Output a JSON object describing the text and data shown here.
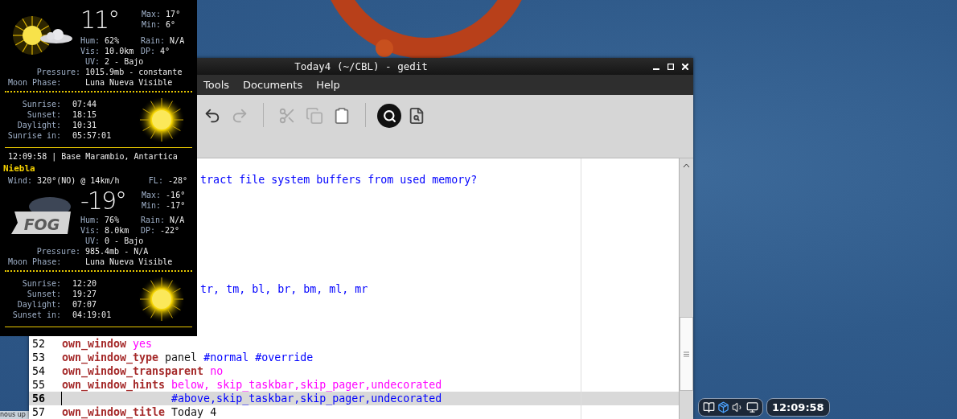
{
  "conky": {
    "blocks": [
      {
        "kind": "sun-cloud",
        "temp": "11°",
        "max": {
          "label": "Max:",
          "value": "17°"
        },
        "min": {
          "label": "Min:",
          "value": "6°"
        },
        "hum": {
          "label": "Hum:",
          "value": "62%"
        },
        "rain": {
          "label": "Rain:",
          "value": "N/A"
        },
        "vis": {
          "label": "Vis:",
          "value": "10.0km"
        },
        "dp": {
          "label": "DP:",
          "value": "4°"
        },
        "uv": {
          "label": "UV:",
          "value": "2 - Bajo"
        },
        "pressure": {
          "label": "Pressure:",
          "value": "1015.9mb - constante"
        },
        "moon": {
          "label": "Moon Phase:",
          "value": "Luna Nueva Visible"
        },
        "sun": [
          {
            "label": "Sunrise:",
            "value": "07:44"
          },
          {
            "label": "Sunset:",
            "value": "18:15"
          },
          {
            "label": "Daylight:",
            "value": "10:31"
          },
          {
            "label": "Sunrise in:",
            "value": "05:57:01"
          }
        ]
      },
      {
        "kind": "fog",
        "header": "12:09:58 | Base Marambio, Antartica",
        "condition": "Niebla",
        "wind": {
          "label": "Wind:",
          "value": "320°(NO) @ 14km/h"
        },
        "feels": {
          "label": "FL:",
          "value": "-28°"
        },
        "icon_label": "FOG",
        "temp": "-19°",
        "max": {
          "label": "Max:",
          "value": "-16°"
        },
        "min": {
          "label": "Min:",
          "value": "-17°"
        },
        "hum": {
          "label": "Hum:",
          "value": "76%"
        },
        "rain": {
          "label": "Rain:",
          "value": "N/A"
        },
        "vis": {
          "label": "Vis:",
          "value": "8.0km"
        },
        "dp": {
          "label": "DP:",
          "value": "-22°"
        },
        "uv": {
          "label": "UV:",
          "value": "0 - Bajo"
        },
        "pressure": {
          "label": "Pressure:",
          "value": "985.4mb - N/A"
        },
        "moon": {
          "label": "Moon Phase:",
          "value": "Luna Nueva Visible"
        },
        "sun": [
          {
            "label": "Sunrise:",
            "value": "12:20"
          },
          {
            "label": "Sunset:",
            "value": "19:27"
          },
          {
            "label": "Daylight:",
            "value": "07:07"
          },
          {
            "label": "Sunset in:",
            "value": "04:19:01"
          }
        ]
      }
    ]
  },
  "gedit": {
    "title": "Today4 (~/CBL) - gedit",
    "menu": [
      "Tools",
      "Documents",
      "Help"
    ],
    "toolbar": [
      {
        "kind": "undo",
        "disabled": false
      },
      {
        "kind": "redo",
        "disabled": true
      },
      {
        "kind": "separator"
      },
      {
        "kind": "cut",
        "disabled": true
      },
      {
        "kind": "copy",
        "disabled": true
      },
      {
        "kind": "paste",
        "disabled": false
      },
      {
        "kind": "separator"
      },
      {
        "kind": "find",
        "disabled": false
      },
      {
        "kind": "replace",
        "disabled": false
      }
    ],
    "lines": [
      {
        "kind": "covered",
        "segments": [
          {
            "text": "tract file system buffers from used memory?",
            "kind": "comment"
          }
        ]
      },
      {
        "kind": "blank"
      },
      {
        "kind": "blank"
      },
      {
        "kind": "blank"
      },
      {
        "kind": "blank"
      },
      {
        "kind": "blank"
      },
      {
        "kind": "blank"
      },
      {
        "kind": "blank"
      },
      {
        "kind": "covered",
        "segments": [
          {
            "text": "tr, tm, bl, br, bm, ml, mr",
            "kind": "comment"
          }
        ]
      },
      {
        "kind": "blank"
      },
      {
        "kind": "blank"
      },
      {
        "kind": "blank"
      },
      {
        "kind": "numbered",
        "number": "52",
        "current": false,
        "segments": [
          {
            "text": "own_window",
            "kind": "keyword"
          },
          {
            "text": "yes",
            "kind": "value"
          }
        ]
      },
      {
        "kind": "numbered",
        "number": "53",
        "current": false,
        "segments": [
          {
            "text": "own_window_type",
            "kind": "keyword"
          },
          {
            "text": "panel",
            "kind": "plain"
          },
          {
            "text": "#normal #override",
            "kind": "comment"
          }
        ]
      },
      {
        "kind": "numbered",
        "number": "54",
        "current": false,
        "segments": [
          {
            "text": "own_window_transparent",
            "kind": "keyword"
          },
          {
            "text": "no",
            "kind": "value"
          }
        ]
      },
      {
        "kind": "numbered",
        "number": "55",
        "current": false,
        "segments": [
          {
            "text": "own_window_hints",
            "kind": "keyword"
          },
          {
            "text": "below, skip_taskbar,skip_pager,undecorated",
            "kind": "value"
          }
        ]
      },
      {
        "kind": "continuation",
        "number": "56",
        "current": true,
        "segments": [
          {
            "text": "#above,skip_taskbar,skip_pager,undecorated",
            "kind": "comment"
          }
        ]
      },
      {
        "kind": "numbered",
        "number": "57",
        "current": false,
        "segments": [
          {
            "text": "own_window_title",
            "kind": "keyword"
          },
          {
            "text": "Today 4",
            "kind": "plain"
          }
        ]
      }
    ]
  },
  "taskbar_item": "nous up",
  "tray": {
    "clock": "12:09:58"
  }
}
